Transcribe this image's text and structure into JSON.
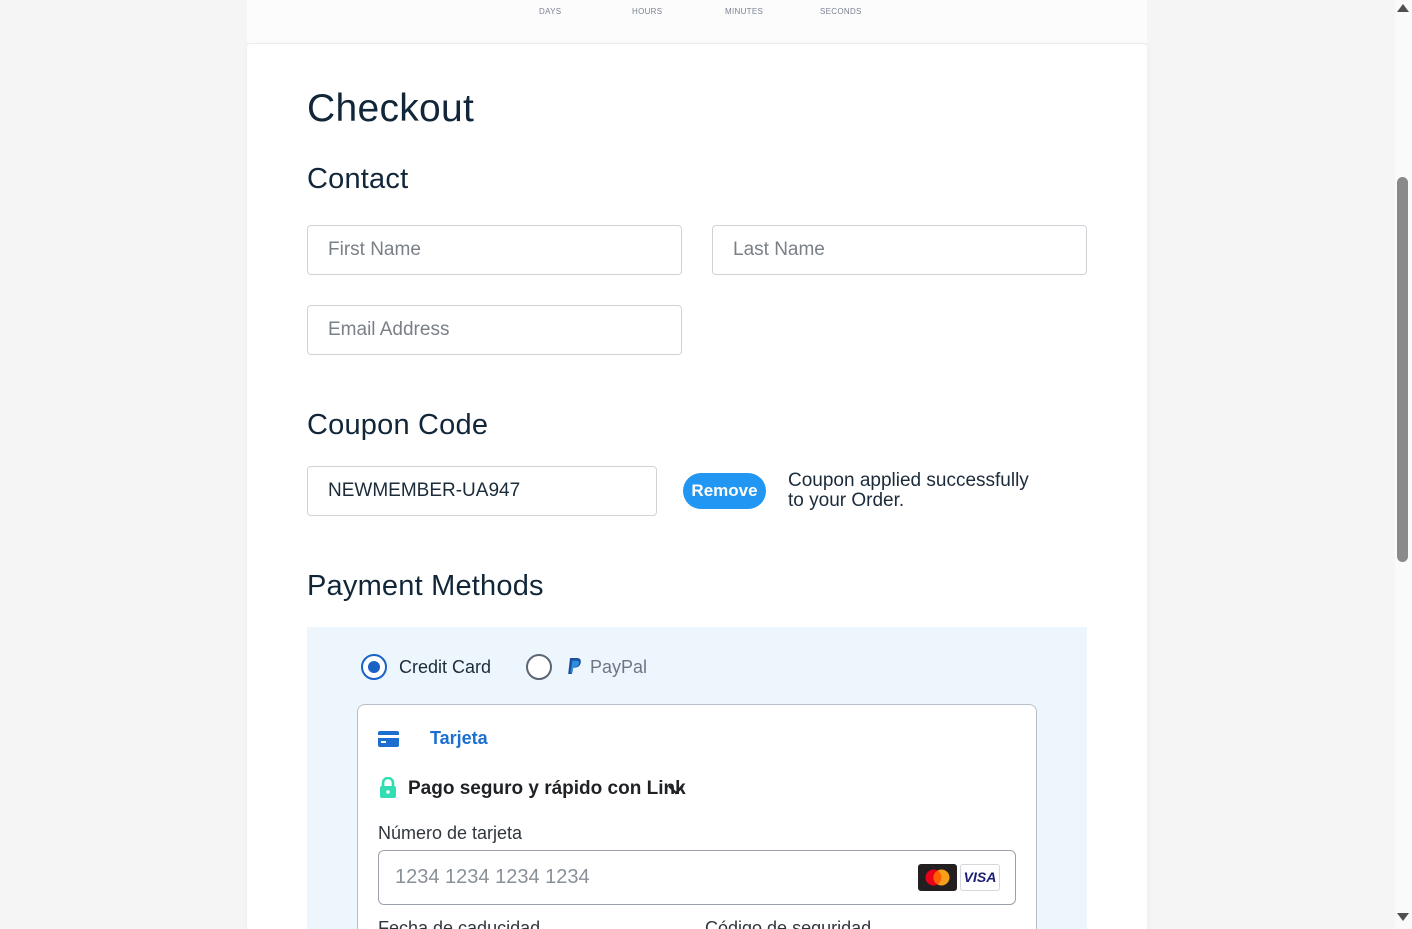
{
  "countdown": {
    "days": "DAYS",
    "hours": "HOURS",
    "minutes": "MINUTES",
    "seconds": "SECONDS"
  },
  "checkout": {
    "title": "Checkout",
    "contact_heading": "Contact",
    "first_name_placeholder": "First Name",
    "last_name_placeholder": "Last Name",
    "email_placeholder": "Email Address",
    "coupon_heading": "Coupon Code",
    "coupon_value": "NEWMEMBER-UA947",
    "remove_label": "Remove",
    "coupon_message": "Coupon applied successfully to your Order.",
    "payment_heading": "Payment Methods"
  },
  "payment": {
    "options": [
      {
        "label": "Credit Card",
        "selected": true
      },
      {
        "label": "PayPal",
        "selected": false
      }
    ],
    "tab_label": "Tarjeta",
    "link_label": "Pago seguro y rápido con Link",
    "card_number_label": "Número de tarjeta",
    "card_number_placeholder": "1234 1234 1234 1234",
    "card_brands": [
      "mastercard",
      "VISA"
    ],
    "expiry_label": "Fecha de caducidad",
    "cvc_label": "Código de seguridad"
  },
  "colors": {
    "accent": "#2196f3",
    "radio_selected": "#1a62c6",
    "panel_bg": "#edf5fd",
    "link_green": "#33ddb3"
  }
}
